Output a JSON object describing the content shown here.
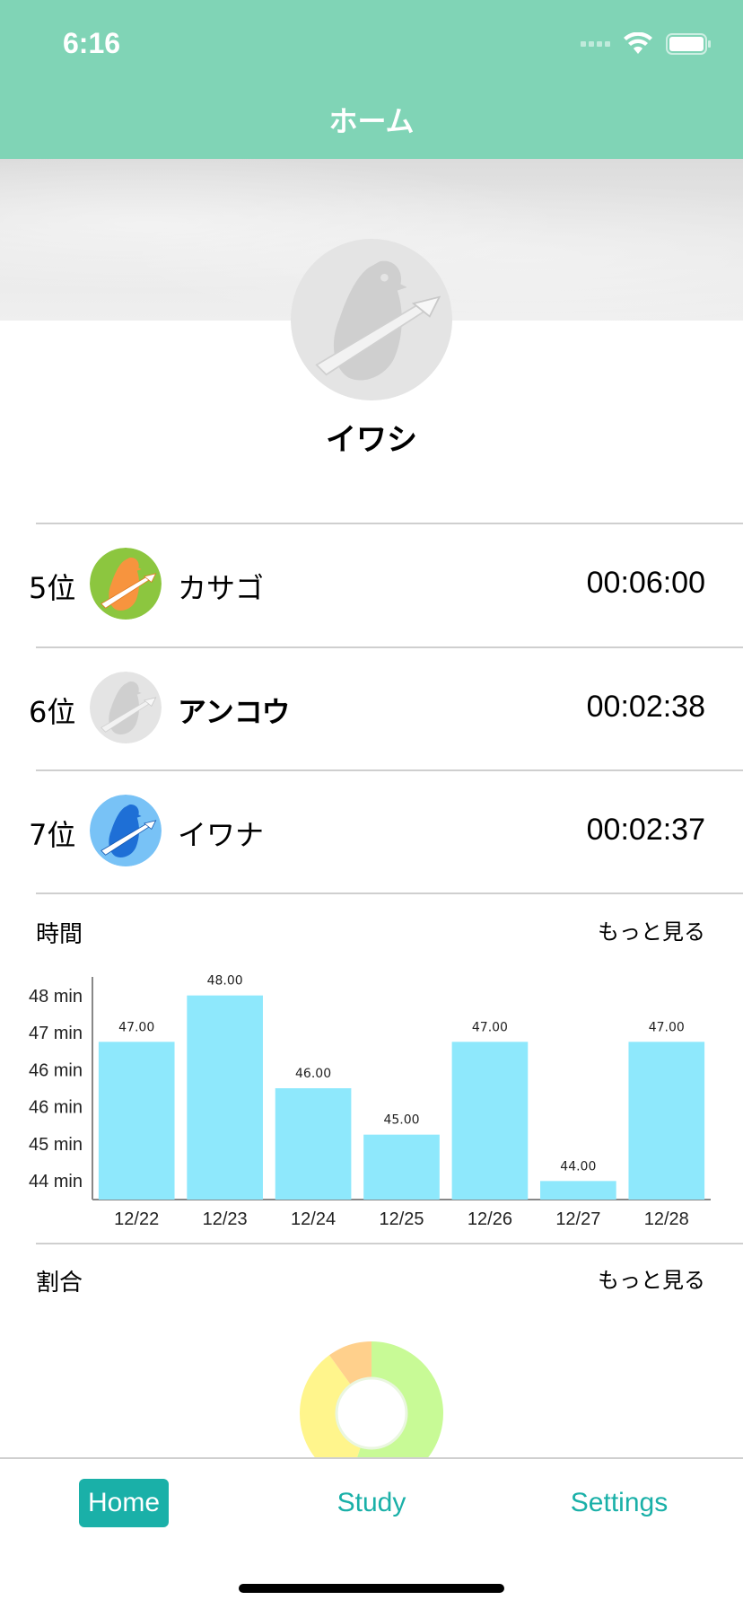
{
  "status_bar": {
    "time": "6:16"
  },
  "nav": {
    "title": "ホーム"
  },
  "profile": {
    "name": "イワシ"
  },
  "ranking": [
    {
      "position": "5位",
      "name": "カサゴ",
      "time": "00:06:00",
      "avatar": "penguin-orange-icon",
      "bold": false
    },
    {
      "position": "6位",
      "name": "アンコウ",
      "time": "00:02:38",
      "avatar": "penguin-gray-icon",
      "bold": true
    },
    {
      "position": "7位",
      "name": "イワナ",
      "time": "00:02:37",
      "avatar": "penguin-blue-icon",
      "bold": false
    }
  ],
  "time_section": {
    "title": "時間",
    "more_label": "もっと見る"
  },
  "ratio_section": {
    "title": "割合",
    "more_label": "もっと見る"
  },
  "chart_data": {
    "type": "bar",
    "categories": [
      "12/22",
      "12/23",
      "12/24",
      "12/25",
      "12/26",
      "12/27",
      "12/28"
    ],
    "values": [
      47.0,
      48.0,
      46.0,
      45.0,
      47.0,
      44.0,
      47.0
    ],
    "data_labels": [
      "47.00",
      "48.00",
      "46.00",
      "45.00",
      "47.00",
      "44.00",
      "47.00"
    ],
    "y_tick_labels": [
      "48 min",
      "47 min",
      "46 min",
      "46 min",
      "45 min",
      "44 min"
    ],
    "ylim": [
      43.6,
      48.4
    ],
    "bar_color": "#8EE8FC",
    "grid": false
  },
  "donut": {
    "type": "pie",
    "slices": [
      {
        "value": 0.55,
        "color": "#C8FA96"
      },
      {
        "value": 0.35,
        "color": "#FFF58C"
      },
      {
        "value": 0.1,
        "color": "#FFD08C"
      }
    ]
  },
  "tabs": [
    {
      "label": "Home",
      "active": true
    },
    {
      "label": "Study",
      "active": false
    },
    {
      "label": "Settings",
      "active": false
    }
  ],
  "colors": {
    "header": "#80D4B6",
    "accent": "#1AB0A8"
  }
}
